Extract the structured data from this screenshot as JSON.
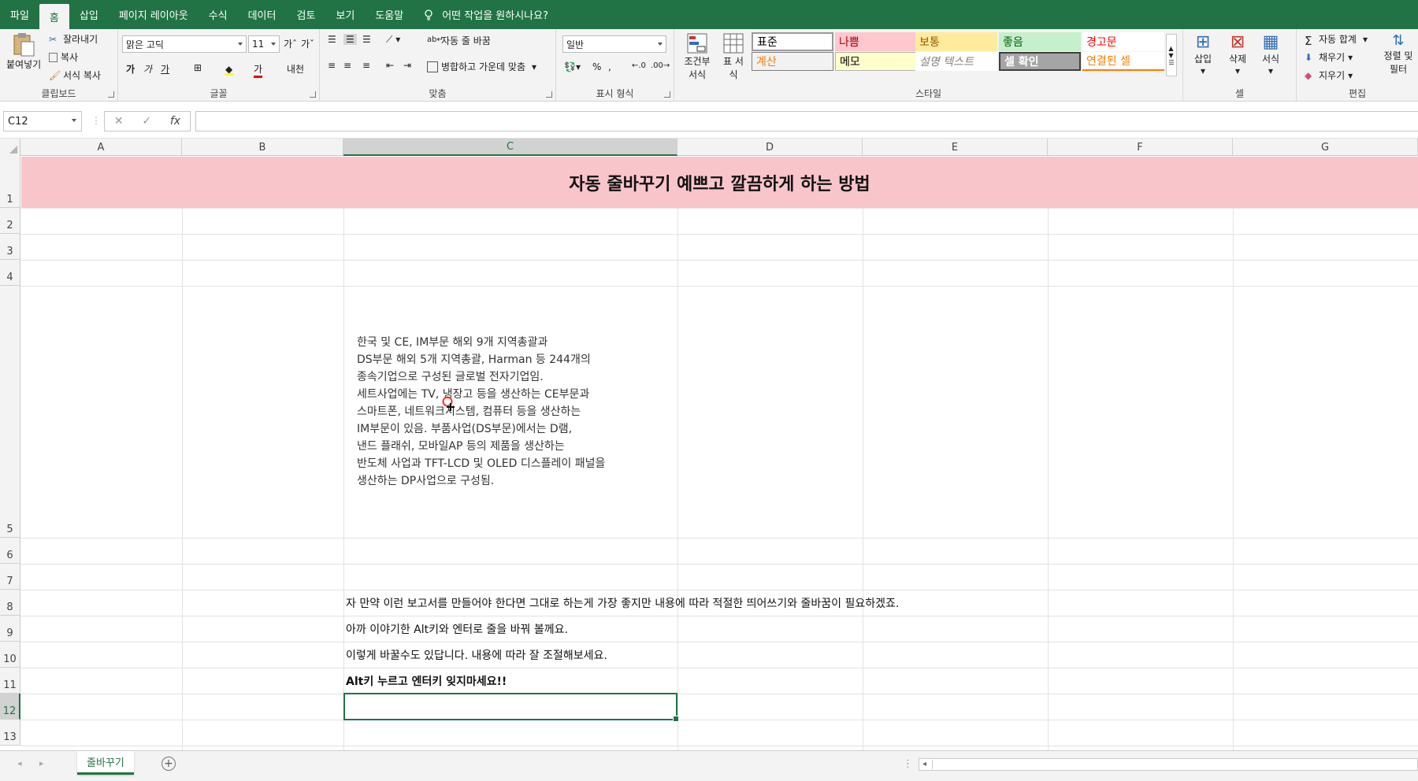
{
  "ribbon_tabs": [
    "파일",
    "홈",
    "삽입",
    "페이지 레이아웃",
    "수식",
    "데이터",
    "검토",
    "보기",
    "도움말"
  ],
  "tell_me": "어떤 작업을 원하시나요?",
  "clipboard": {
    "paste": "붙여넣기",
    "cut": "잘라내기",
    "copy": "복사",
    "format_painter": "서식 복사",
    "label": "클립보드"
  },
  "font": {
    "name": "맑은 고딕",
    "size": "11",
    "label": "글꼴"
  },
  "alignment": {
    "wrap_text": "자동 줄 바꿈",
    "merge_center": "병합하고 가운데 맞춤",
    "label": "맞춤"
  },
  "number": {
    "format": "일반",
    "label": "표시 형식"
  },
  "styles": {
    "conditional": "조건부 서식",
    "table": "표 서식",
    "label": "스타일",
    "cells": [
      {
        "name": "표준",
        "bg": "#ffffff",
        "color": "#000000"
      },
      {
        "name": "나쁨",
        "bg": "#ffc7ce",
        "color": "#9c0006"
      },
      {
        "name": "보통",
        "bg": "#ffeb9c",
        "color": "#9c5700"
      },
      {
        "name": "좋음",
        "bg": "#c6efce",
        "color": "#006100"
      },
      {
        "name": "경고문",
        "bg": "#ffffff",
        "color": "#ff0000"
      },
      {
        "name": "계산",
        "bg": "#f2f2f2",
        "color": "#fa7d00"
      },
      {
        "name": "메모",
        "bg": "#ffffcc",
        "color": "#000000"
      },
      {
        "name": "설명 텍스트",
        "bg": "#ffffff",
        "color": "#7f7f7f"
      },
      {
        "name": "셀 확인",
        "bg": "#a5a5a5",
        "color": "#ffffff"
      },
      {
        "name": "연결된 셀",
        "bg": "#ffffff",
        "color": "#fa7d00"
      }
    ]
  },
  "cells_group": {
    "insert": "삽입",
    "delete": "삭제",
    "format": "서식",
    "label": "셀"
  },
  "editing": {
    "autosum": "자동 합계",
    "fill": "채우기",
    "clear": "지우기",
    "sort_filter": "정렬 및 필터",
    "label": "편집"
  },
  "formula_bar": {
    "name_box": "C12",
    "fx": "fx",
    "value": ""
  },
  "columns": [
    "A",
    "B",
    "C",
    "D",
    "E",
    "F",
    "G"
  ],
  "rows": [
    "1",
    "2",
    "3",
    "4",
    "5",
    "6",
    "7",
    "8",
    "9",
    "10",
    "11",
    "12",
    "13"
  ],
  "sheet": {
    "title": "자동 줄바꾸기 예쁘고 깔끔하게 하는 방법",
    "c5_text": "한국 및 CE, IM부문 해외 9개 지역총괄과\nDS부문 해외 5개 지역총괄, Harman 등 244개의\n종속기업으로 구성된 글로벌 전자기업임.\n세트사업에는 TV, 냉장고 등을 생산하는 CE부문과\n스마트폰, 네트워크시스템, 컴퓨터 등을 생산하는\nIM부문이 있음. 부품사업(DS부문)에서는 D램,\n낸드 플래쉬, 모바일AP 등의 제품을 생산하는\n반도체 사업과 TFT-LCD 및 OLED 디스플레이 패널을\n생산하는 DP사업으로 구성됨.",
    "c8": "자 만약 이런 보고서를 만들어야 한다면 그대로 하는게 가장 좋지만 내용에 따라 적절한 띄어쓰기와 줄바꿈이 필요하겠죠.",
    "c9": "아까 이야기한 Alt키와 엔터로 줄을 바꿔 볼께요.",
    "c10": "이렇게 바꿀수도 있답니다. 내용에 따라 잘 조절해보세요.",
    "c11": "Alt키 누르고 엔터키 잊지마세요!!"
  },
  "sheet_tab": "줄바꾸기",
  "accent": "#217346"
}
